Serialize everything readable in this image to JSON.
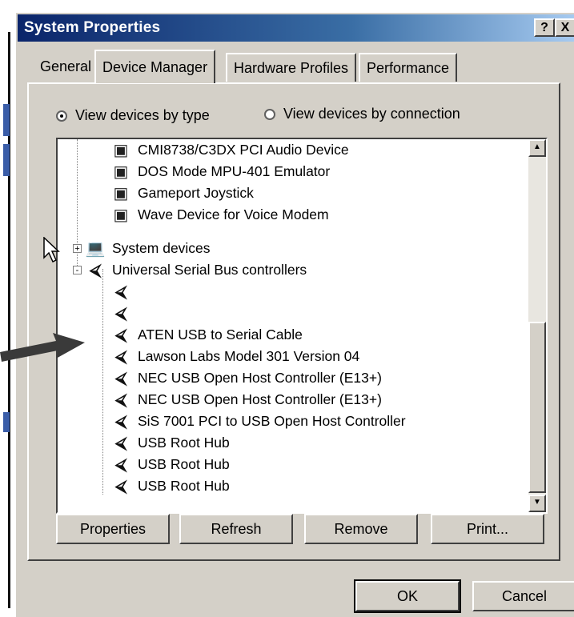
{
  "window": {
    "title": "System Properties",
    "help_button": "?",
    "close_button": "X"
  },
  "tabs": [
    {
      "label": "General",
      "active": false
    },
    {
      "label": "Device Manager",
      "active": true
    },
    {
      "label": "Hardware Profiles",
      "active": false
    },
    {
      "label": "Performance",
      "active": false
    }
  ],
  "view_options": {
    "by_type": {
      "label": "View devices by type",
      "selected": true
    },
    "by_connection": {
      "label": "View devices by connection",
      "selected": false
    }
  },
  "device_tree": {
    "rows": [
      {
        "label": "CMI8738/C3DX PCI Audio Device",
        "icon": "sound-device-icon",
        "level": 2
      },
      {
        "label": "DOS Mode MPU-401 Emulator",
        "icon": "sound-device-icon",
        "level": 2
      },
      {
        "label": "Gameport Joystick",
        "icon": "sound-device-icon",
        "level": 2
      },
      {
        "label": "Wave Device for Voice Modem",
        "icon": "sound-device-icon",
        "level": 2
      },
      {
        "label": "System devices",
        "icon": "computer-icon",
        "level": 1,
        "expander": "+"
      },
      {
        "label": "Universal Serial Bus controllers",
        "icon": "usb-icon",
        "level": 1,
        "expander": "-"
      },
      {
        "label": "",
        "icon": "usb-icon",
        "level": 2
      },
      {
        "label": "",
        "icon": "usb-icon",
        "level": 2
      },
      {
        "label": "ATEN USB to Serial Cable",
        "icon": "usb-icon",
        "level": 2
      },
      {
        "label": "Lawson Labs Model 301 Version 04",
        "icon": "usb-icon",
        "level": 2
      },
      {
        "label": "NEC USB Open Host Controller (E13+)",
        "icon": "usb-icon",
        "level": 2
      },
      {
        "label": "NEC USB Open Host Controller (E13+)",
        "icon": "usb-icon",
        "level": 2
      },
      {
        "label": "SiS 7001 PCI to USB Open Host Controller",
        "icon": "usb-icon",
        "level": 2
      },
      {
        "label": "USB Root Hub",
        "icon": "usb-icon",
        "level": 2
      },
      {
        "label": "USB Root Hub",
        "icon": "usb-icon",
        "level": 2
      },
      {
        "label": "USB Root Hub",
        "icon": "usb-icon",
        "level": 2
      }
    ]
  },
  "buttons": {
    "properties": "Properties",
    "refresh": "Refresh",
    "remove": "Remove",
    "print": "Print...",
    "ok": "OK",
    "cancel": "Cancel"
  },
  "colors": {
    "dialog_face": "#d4d0c8",
    "title_start": "#0a246a",
    "title_end": "#a6caf0"
  }
}
